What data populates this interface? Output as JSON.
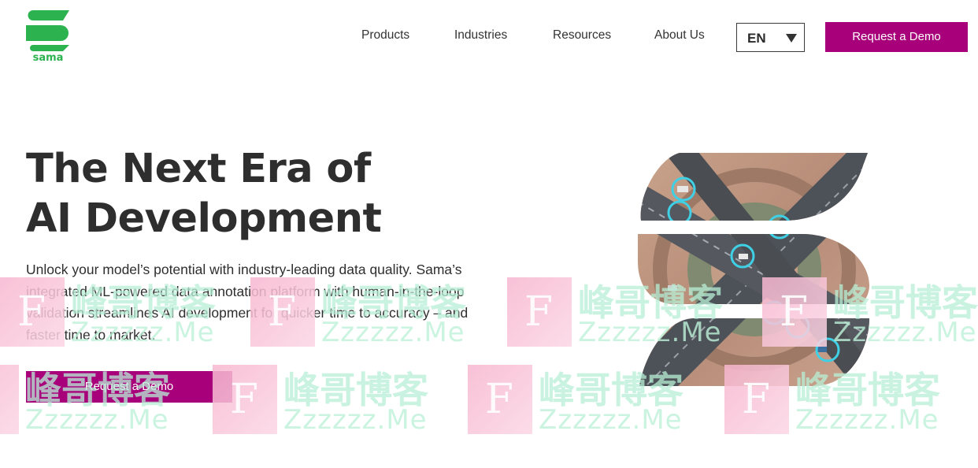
{
  "brand": {
    "name": "sama",
    "color": "#2cb34f"
  },
  "nav": {
    "items": [
      "Products",
      "Industries",
      "Resources",
      "About Us"
    ],
    "language": {
      "selected": "EN",
      "caret_icon": "caret-down-icon"
    },
    "cta_label": "Request a Demo"
  },
  "hero": {
    "title_lines": [
      "The Next Era of",
      "AI Development"
    ],
    "description": "Unlock your model’s potential with industry-leading data quality. Sama’s integrated ML-powered data annotation platform with human-in-the-loop validation streamlines AI development for quicker time to accuracy – and faster time to market.",
    "cta_label": "Request a Demo"
  },
  "watermark": {
    "letter": "F",
    "chinese": "峰哥博客",
    "english": "Zzzzzz.Me"
  },
  "colors": {
    "accent": "#a7007a",
    "text": "#2e2e2e",
    "highlight": "#3fd0e6"
  }
}
